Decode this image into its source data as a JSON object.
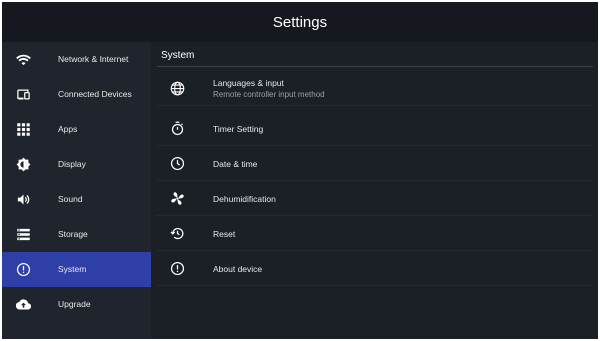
{
  "header": {
    "title": "Settings"
  },
  "sidebar": {
    "items": [
      {
        "label": "Network & Internet",
        "icon": "wifi-icon"
      },
      {
        "label": "Connected Devices",
        "icon": "connected-devices-icon"
      },
      {
        "label": "Apps",
        "icon": "apps-grid-icon"
      },
      {
        "label": "Display",
        "icon": "brightness-icon"
      },
      {
        "label": "Sound",
        "icon": "speaker-icon"
      },
      {
        "label": "Storage",
        "icon": "storage-icon"
      },
      {
        "label": "System",
        "icon": "info-icon",
        "selected": true
      },
      {
        "label": "Upgrade",
        "icon": "cloud-upload-icon"
      }
    ]
  },
  "main": {
    "section_title": "System",
    "rows": [
      {
        "label": "Languages & input",
        "sublabel": "Remote controller input method",
        "icon": "globe-icon"
      },
      {
        "label": "Timer Setting",
        "icon": "stopwatch-icon"
      },
      {
        "label": "Date & time",
        "icon": "clock-icon"
      },
      {
        "label": "Dehumidification",
        "icon": "fan-icon"
      },
      {
        "label": "Reset",
        "icon": "restore-icon"
      },
      {
        "label": "About device",
        "icon": "info-icon"
      }
    ]
  },
  "colors": {
    "background": "#1b1f26",
    "sidebar": "#20242c",
    "selected": "#2f3fa8",
    "text": "#e8e8e8",
    "subtext": "#9aa0a8"
  }
}
